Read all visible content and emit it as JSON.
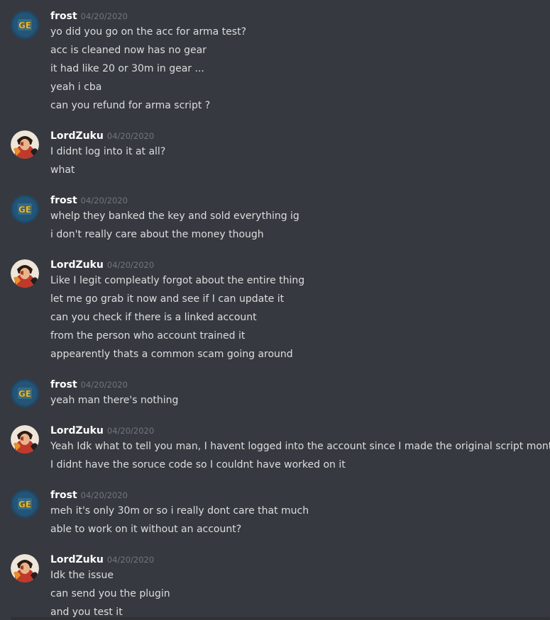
{
  "users": {
    "frost": {
      "name": "frost",
      "avatar_icon": "gc-badge-avatar",
      "accent": "#f0b232"
    },
    "zuko": {
      "name": "LordZuku",
      "avatar_icon": "character-portrait-avatar",
      "accent": "#c0392b"
    }
  },
  "messages": [
    {
      "user": "frost",
      "timestamp": "04/20/2020",
      "lines": [
        "yo did you go on the acc for arma test?",
        "acc is cleaned now has no gear",
        "it had like 20 or 30m in gear ...",
        "yeah i cba",
        "can you refund for arma script ?"
      ]
    },
    {
      "user": "zuko",
      "timestamp": "04/20/2020",
      "lines": [
        "I didnt log into it at all?",
        "what"
      ]
    },
    {
      "user": "frost",
      "timestamp": "04/20/2020",
      "lines": [
        "whelp they banked the key and sold everything ig",
        "i don't really care about the money though"
      ]
    },
    {
      "user": "zuko",
      "timestamp": "04/20/2020",
      "lines": [
        "Like I legit compleatly forgot about the entire thing",
        "let me go grab it now and see if I can update it",
        "can you check if there is a linked account",
        "from the person who account trained it",
        "appearently thats a common scam going around"
      ]
    },
    {
      "user": "frost",
      "timestamp": "04/20/2020",
      "lines": [
        "yeah man there's nothing"
      ]
    },
    {
      "user": "zuko",
      "timestamp": "04/20/2020",
      "lines": [
        "Yeah Idk what to tell you man, I havent logged into the account since I made the original script months ago",
        "I didnt have the soruce code so I couldnt have worked on it"
      ]
    },
    {
      "user": "frost",
      "timestamp": "04/20/2020",
      "lines": [
        "meh it's only 30m or so i really dont care that much",
        "able to work on it without an account?"
      ]
    },
    {
      "user": "zuko",
      "timestamp": "04/20/2020",
      "lines": [
        "Idk the issue",
        "can send you the plugin",
        "and you test it"
      ]
    }
  ]
}
